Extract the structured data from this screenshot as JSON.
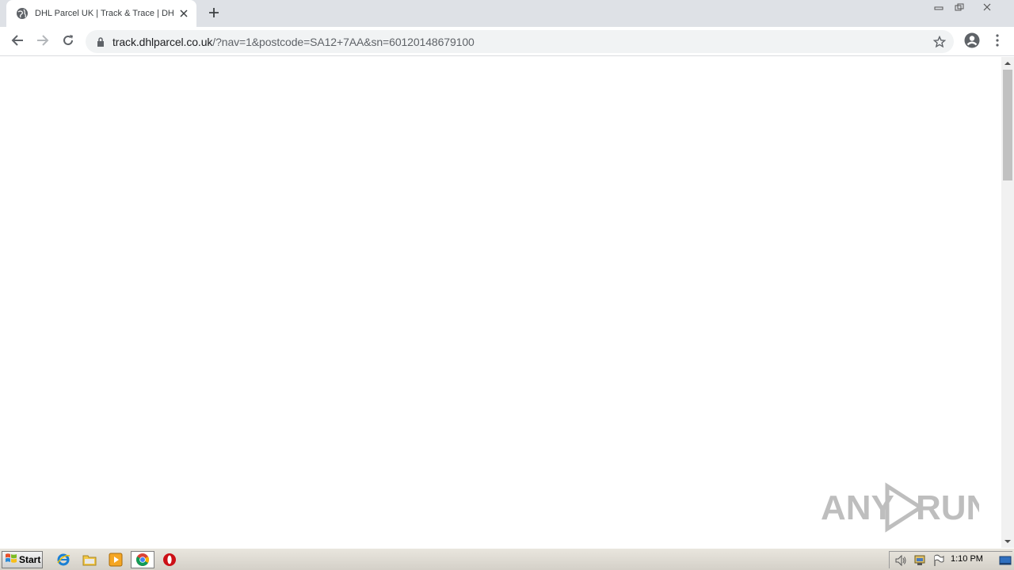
{
  "browser": {
    "tab": {
      "title": "DHL Parcel UK | Track & Trace | DHL Parcel",
      "favicon": "globe-icon"
    },
    "new_tab": "plus-icon",
    "window_controls": [
      "minimize-icon",
      "restore-icon",
      "close-icon"
    ],
    "toolbar": {
      "back": "arrow-left-icon",
      "forward": "arrow-right-icon",
      "reload": "reload-icon",
      "url_host": "track.dhlparcel.co.uk",
      "url_rest": "/?nav=1&postcode=SA12+7AA&sn=60120148679100",
      "bookmark": "star-icon",
      "profile": "account-circle-icon",
      "menu": "kebab-menu-icon"
    }
  },
  "page": {
    "content": ""
  },
  "watermark": {
    "text_left": "ANY",
    "text_right": "RUN"
  },
  "taskbar": {
    "start_label": "Start",
    "pinned": [
      "internet-explorer-icon",
      "file-explorer-icon",
      "media-player-icon",
      "chrome-icon",
      "opera-icon"
    ],
    "clock": "1:10 PM"
  },
  "colors": {
    "tabstrip": "#dee1e6",
    "omnibox": "#f1f3f4",
    "taskbar": "#d4d0c8"
  }
}
